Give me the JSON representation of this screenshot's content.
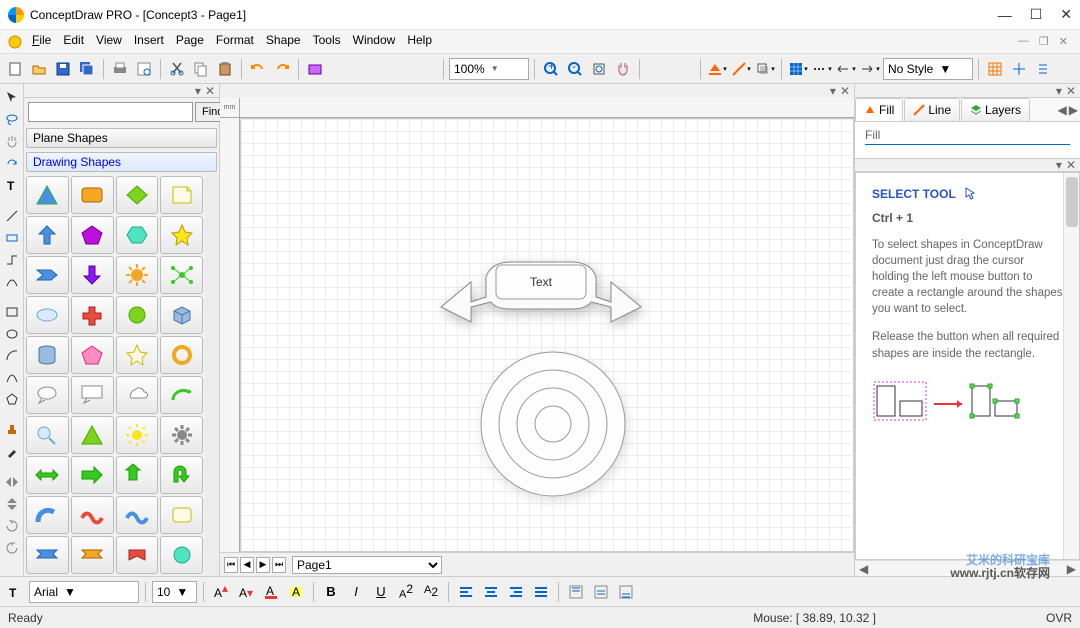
{
  "titlebar": {
    "title": "ConceptDraw PRO - [Concept3 - Page1]"
  },
  "menu": {
    "file": "File",
    "edit": "Edit",
    "view": "View",
    "insert": "Insert",
    "page": "Page",
    "format": "Format",
    "shape": "Shape",
    "tools": "Tools",
    "window": "Window",
    "help": "Help"
  },
  "toolbar": {
    "zoom": "100%",
    "style": "No Style"
  },
  "shapes": {
    "find_btn": "Find",
    "cat1": "Plane Shapes",
    "cat2": "Drawing Shapes"
  },
  "canvas": {
    "banner_text": "Text",
    "ruler_unit": "mm"
  },
  "page": {
    "current": "Page1"
  },
  "right": {
    "tabs": {
      "fill": "Fill",
      "line": "Line",
      "layers": "Layers"
    },
    "fill_label": "Fill",
    "help_title": "SELECT TOOL",
    "help_shortcut": "Ctrl + 1",
    "help_p1": "To select shapes in ConceptDraw document just drag the cursor holding the left mouse button to create a rectangle around the shapes you want to select.",
    "help_p2": "Release the button when all required shapes are inside the rectangle."
  },
  "fontbar": {
    "font": "Arial",
    "size": "10"
  },
  "status": {
    "ready": "Ready",
    "mouse": "Mouse: [ 38.89, 10.32 ]",
    "ovr": "OVR"
  },
  "watermark": {
    "l1": "艾米的科研宝库",
    "l2": "www.rjtj.cn软存网"
  }
}
